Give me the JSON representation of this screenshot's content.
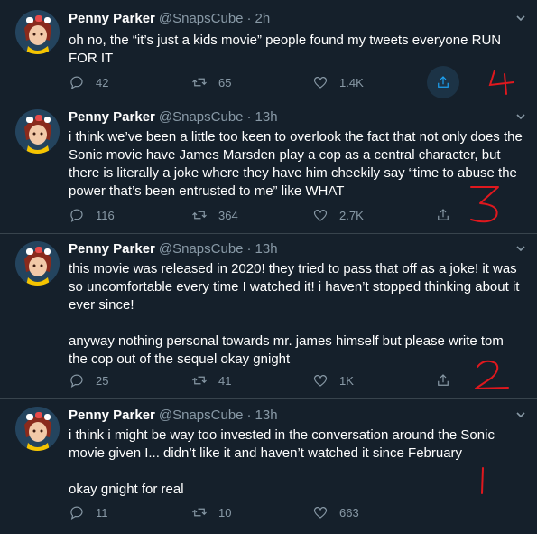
{
  "tweets": [
    {
      "name": "Penny Parker",
      "handle": "@SnapsCube",
      "sep": "·",
      "time": "2h",
      "text": "oh no, the “it’s just a kids movie” people found my tweets everyone RUN FOR IT",
      "replies": "42",
      "retweets": "65",
      "likes": "1.4K"
    },
    {
      "name": "Penny Parker",
      "handle": "@SnapsCube",
      "sep": "·",
      "time": "13h",
      "text": "i think we’ve been a little too keen to overlook the fact that not only does the Sonic movie have James Marsden play a cop as a central character, but there is literally a joke where they have him cheekily say “time to abuse the power that’s been entrusted to me” like WHAT",
      "replies": "116",
      "retweets": "364",
      "likes": "2.7K"
    },
    {
      "name": "Penny Parker",
      "handle": "@SnapsCube",
      "sep": "·",
      "time": "13h",
      "text": "this movie was released in 2020! they tried to pass that off as a joke! it was so uncomfortable every time I watched it! i haven’t stopped thinking about it ever since!\n\nanyway nothing personal towards mr. james himself but please write tom the cop out of the sequel okay gnight",
      "replies": "25",
      "retweets": "41",
      "likes": "1K"
    },
    {
      "name": "Penny Parker",
      "handle": "@SnapsCube",
      "sep": "·",
      "time": "13h",
      "text": "i think i might be way too invested in the conversation around the Sonic movie given I... didn’t like it and haven’t watched it since February\n\nokay gnight for real",
      "replies": "11",
      "retweets": "10",
      "likes": "663"
    }
  ],
  "annotations": {
    "color": "#e0181e",
    "labels": [
      "4",
      "3",
      "2",
      "1"
    ]
  },
  "colors": {
    "background": "#15202b",
    "muted": "#8899a6",
    "divider": "#38444d",
    "accent": "#1da1f2"
  },
  "icons": {
    "reply": "reply-icon",
    "retweet": "retweet-icon",
    "like": "heart-icon",
    "share": "share-icon",
    "menu": "chevron-down-icon"
  }
}
